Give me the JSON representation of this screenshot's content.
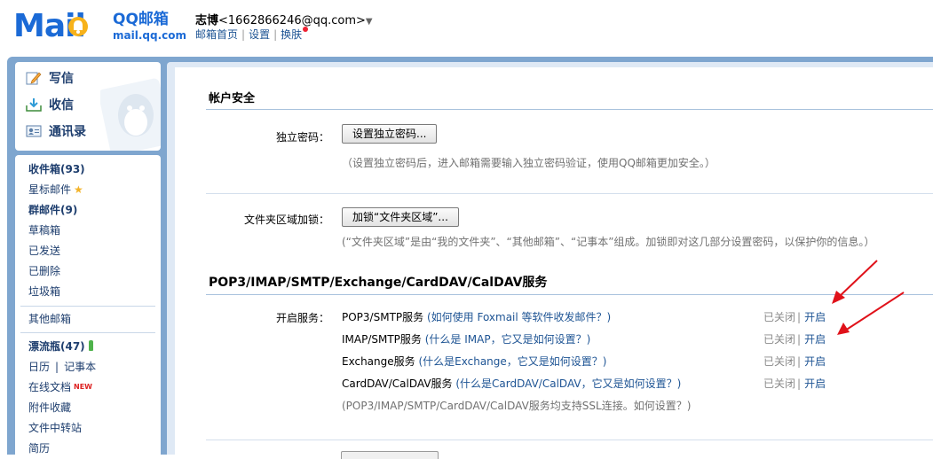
{
  "header": {
    "logo_text": "Mail",
    "brand_name": "QQ邮箱",
    "brand_url": "mail.qq.com",
    "user_name": "志博",
    "user_email": "<1662866246@qq.com>",
    "user_caret": "▼",
    "links": [
      "邮箱首页",
      "设置",
      "换肤"
    ],
    "link_separator": "|",
    "brand_color": "#1b6ad6"
  },
  "nav": {
    "actions": [
      {
        "label": "写信",
        "icon": "pencil-paper-icon"
      },
      {
        "label": "收信",
        "icon": "download-inbox-icon"
      },
      {
        "label": "通讯录",
        "icon": "contact-card-icon"
      }
    ],
    "folders": [
      {
        "label": "收件箱(93)",
        "bold": true
      },
      {
        "label": "星标邮件",
        "icon": "star-icon"
      },
      {
        "label": "群邮件(9)",
        "bold": true
      },
      {
        "label": "草稿箱"
      },
      {
        "label": "已发送"
      },
      {
        "label": "已删除"
      },
      {
        "label": "垃圾箱"
      }
    ],
    "other_mailbox": "其他邮箱",
    "apps": [
      {
        "label": "漂流瓶(47)",
        "bold": true,
        "icon": "bottle-icon"
      },
      {
        "label": "日历",
        "label2": "记事本"
      },
      {
        "label": "在线文档",
        "badge": "NEW"
      },
      {
        "label": "附件收藏"
      },
      {
        "label": "文件中转站"
      },
      {
        "label": "简历"
      }
    ],
    "star_glyph": "★"
  },
  "account_security": {
    "title": "帐户安全",
    "password_label": "独立密码：",
    "password_button": "设置独立密码...",
    "password_hint": "（设置独立密码后，进入邮箱需要输入独立密码验证，使用QQ邮箱更加安全。）",
    "folder_lock_label": "文件夹区域加锁：",
    "folder_lock_button": "加锁“文件夹区域”...",
    "folder_lock_hint": "(“文件夹区域”是由“我的文件夹”、“其他邮箱”、“记事本”组成。加锁即对这几部分设置密码，以保护你的信息。）"
  },
  "services": {
    "title": "POP3/IMAP/SMTP/Exchange/CardDAV/CalDAV服务",
    "enable_label": "开启服务：",
    "items": [
      {
        "name": "POP3/SMTP服务",
        "help": "(如何使用 Foxmail 等软件收发邮件？)",
        "status": "已关闭",
        "action": "开启"
      },
      {
        "name": "IMAP/SMTP服务",
        "help": "(什么是 IMAP，它又是如何设置？)",
        "status": "已关闭",
        "action": "开启"
      },
      {
        "name": "Exchange服务",
        "help": "(什么是Exchange，它又是如何设置？)",
        "status": "已关闭",
        "action": "开启"
      },
      {
        "name": "CardDAV/CalDAV服务",
        "help": "(什么是CardDAV/CalDAV，它又是如何设置？)",
        "status": "已关闭",
        "action": "开启"
      }
    ],
    "ssl_note": "(POP3/IMAP/SMTP/CardDAV/CalDAV服务均支持SSL连接。如何设置？)",
    "separator": "|"
  },
  "colors": {
    "link": "#1e5494",
    "frame": "#7fa6cf",
    "annotation_arrow": "#e0121a"
  }
}
